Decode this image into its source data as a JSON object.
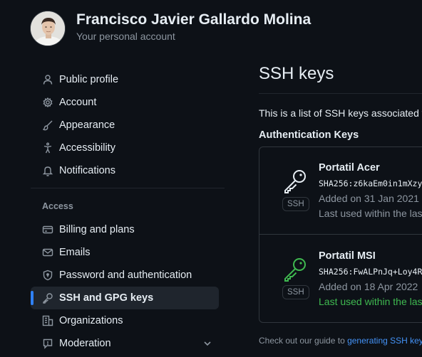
{
  "user": {
    "name": "Francisco Javier Gallardo Molina",
    "subtitle": "Your personal account"
  },
  "sidebar": {
    "items": [
      {
        "label": "Public profile",
        "icon": "person-icon"
      },
      {
        "label": "Account",
        "icon": "gear-icon"
      },
      {
        "label": "Appearance",
        "icon": "paintbrush-icon"
      },
      {
        "label": "Accessibility",
        "icon": "accessibility-icon"
      },
      {
        "label": "Notifications",
        "icon": "bell-icon"
      }
    ],
    "access_label": "Access",
    "access_items": [
      {
        "label": "Billing and plans",
        "icon": "credit-card-icon"
      },
      {
        "label": "Emails",
        "icon": "mail-icon"
      },
      {
        "label": "Password and authentication",
        "icon": "shield-lock-icon"
      },
      {
        "label": "SSH and GPG keys",
        "icon": "key-icon",
        "active": true
      },
      {
        "label": "Organizations",
        "icon": "organization-icon"
      },
      {
        "label": "Moderation",
        "icon": "report-icon"
      }
    ]
  },
  "main": {
    "title": "SSH keys",
    "intro": "This is a list of SSH keys associated w",
    "auth_heading": "Authentication Keys",
    "keys": [
      {
        "title": "Portatil Acer",
        "fingerprint": "SHA256:z6kaEm0in1mXzy",
        "added": "Added on 31 Jan 2021",
        "last_used": "Last used within the las",
        "badge": "SSH",
        "icon_color": "#e6edf3"
      },
      {
        "title": "Portatil MSI",
        "fingerprint": "SHA256:FwALPnJq+Loy4R",
        "added": "Added on 18 Apr 2022",
        "last_used": "Last used within the las",
        "badge": "SSH",
        "icon_color": "#3fb950"
      }
    ],
    "footer_prefix": "Check out our guide to ",
    "footer_link": "generating SSH key"
  },
  "colors": {
    "background": "#0d1117",
    "accent": "#2f81f7",
    "success": "#3fb950",
    "muted": "#8d96a0"
  }
}
